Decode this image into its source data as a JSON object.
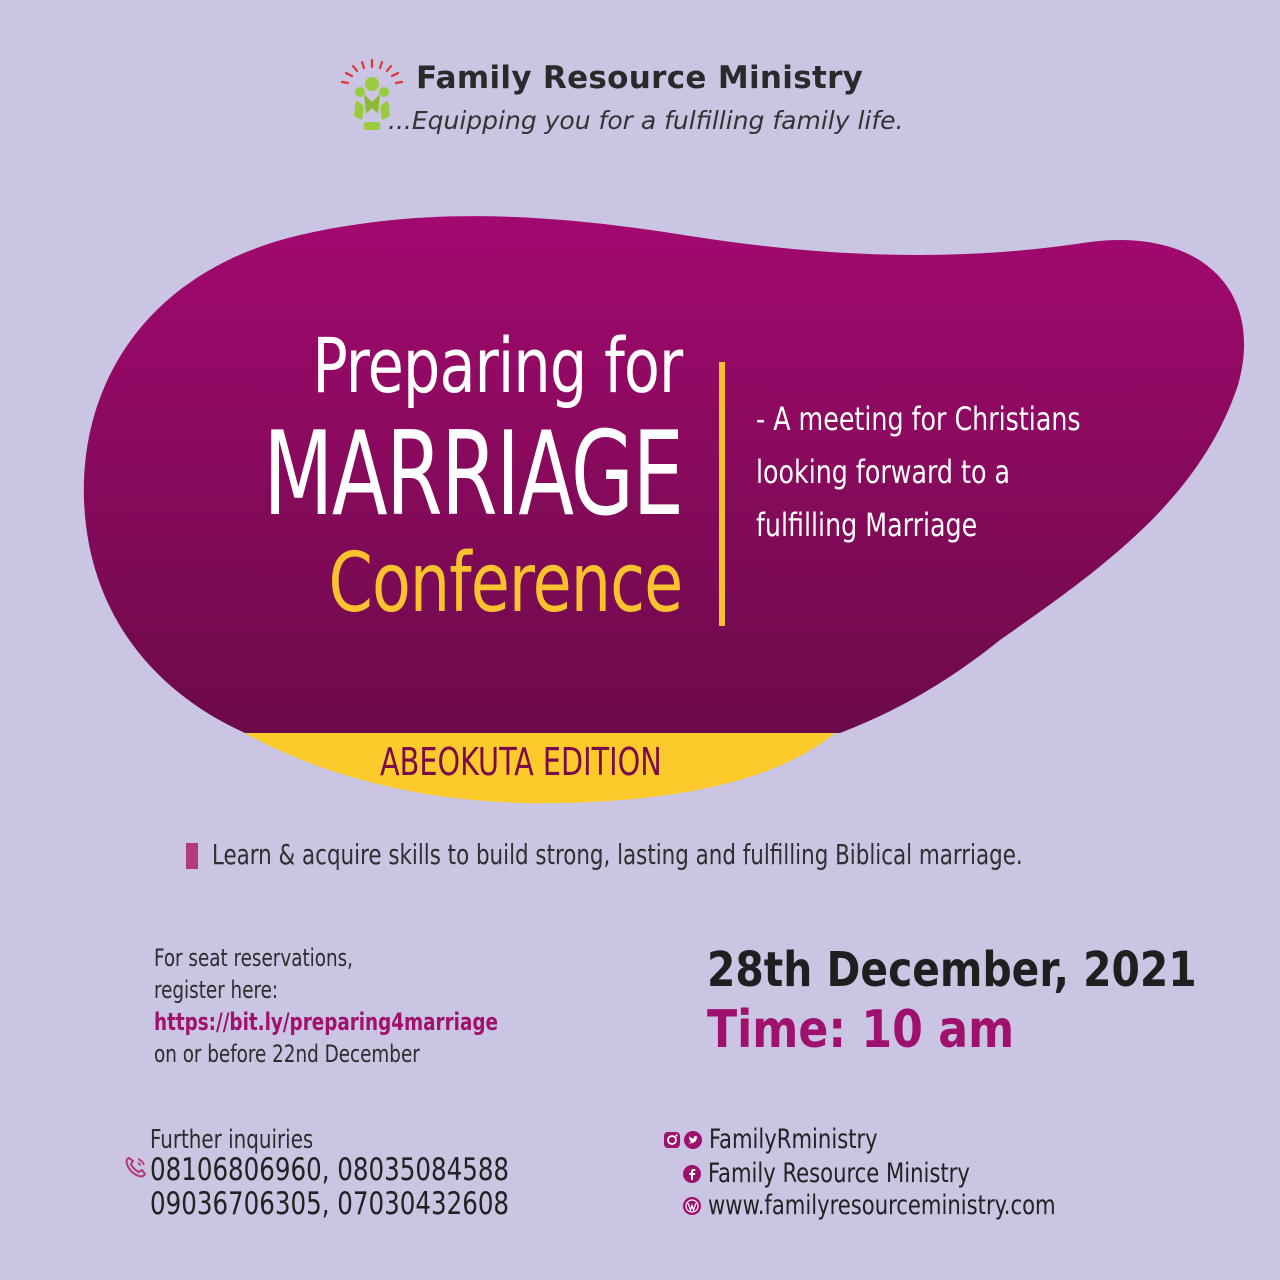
{
  "header": {
    "org_name": "Family Resource Ministry",
    "tagline": "...Equipping you for a fulfilling family life."
  },
  "hero": {
    "title_line1": "Preparing for",
    "title_line2": "MARRIAGE",
    "title_line3": "Conference",
    "description": [
      "- A meeting for Christians",
      "looking forward to a",
      "fulfilling Marriage"
    ],
    "edition": "ABEOKUTA EDITION"
  },
  "bullet": "Learn & acquire skills to build strong, lasting and fulfilling Biblical marriage.",
  "registration": {
    "line1": "For seat reservations,",
    "line2": "register here:",
    "link": "https://bit.ly/preparing4marriage",
    "line3": "on or before 22nd December"
  },
  "event": {
    "date": "28th December, 2021",
    "time": "Time: 10 am"
  },
  "inquiries": {
    "label": "Further inquiries",
    "phones_line1": "08106806960,  08035084588",
    "phones_line2": "09036706305,  07030432608"
  },
  "social": {
    "handle": "FamilyRministry",
    "facebook": "Family Resource Ministry",
    "website": "www.familyresourceministry.com"
  },
  "colors": {
    "background": "#c9c5e2",
    "blob_top": "#a3096f",
    "blob_bottom": "#6c0a4a",
    "accent_yellow": "#f9c22e",
    "accent_magenta": "#a0106e"
  },
  "icons": [
    "phone-icon",
    "instagram-icon",
    "twitter-icon",
    "facebook-icon",
    "wordpress-icon",
    "ministry-logo"
  ]
}
